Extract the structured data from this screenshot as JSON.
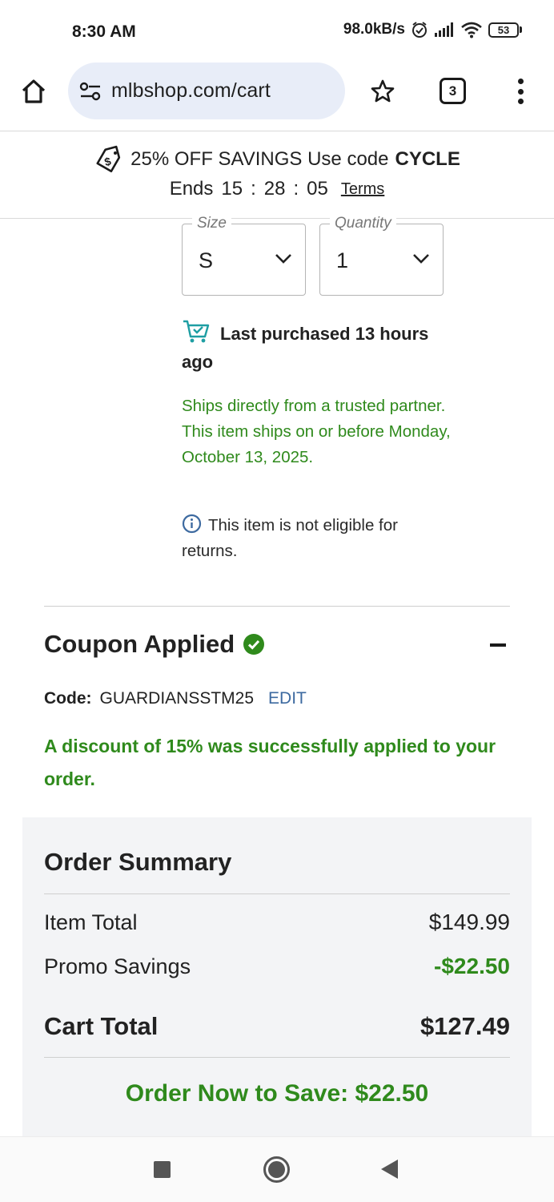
{
  "status_bar": {
    "time": "8:30 AM",
    "net_speed": "98.0kB/s",
    "battery": "53",
    "icons": [
      "alarm-icon",
      "signal-icon",
      "wifi-icon",
      "battery-icon"
    ]
  },
  "browser": {
    "url": "mlbshop.com/cart",
    "tab_count": "3",
    "icons": [
      "home-icon",
      "site-settings-icon",
      "bookmark-star-icon",
      "tabs-icon",
      "more-menu-icon"
    ]
  },
  "promo": {
    "offer_text": "25% OFF SAVINGS Use code",
    "code": "CYCLE",
    "ends_label": "Ends",
    "countdown_h": "15",
    "countdown_m": "28",
    "countdown_s": "05",
    "separator": ":",
    "terms": "Terms"
  },
  "item": {
    "size_label": "Size",
    "size_value": "S",
    "quantity_label": "Quantity",
    "quantity_value": "1",
    "last_purchased": "Last purchased 13 hours ago",
    "shipping_note": "Ships directly from a trusted partner. This item ships on or before Monday, October 13, 2025.",
    "returns_note": "This item is not eligible for returns."
  },
  "coupon": {
    "title": "Coupon Applied",
    "code_label": "Code:",
    "code_value": "GUARDIANSSTM25",
    "edit_label": "EDIT",
    "success_message": "A discount of 15% was successfully applied to your order."
  },
  "summary": {
    "title": "Order Summary",
    "item_total_label": "Item Total",
    "item_total_value": "$149.99",
    "promo_label": "Promo Savings",
    "promo_value": "-$22.50",
    "cart_total_label": "Cart Total",
    "cart_total_value": "$127.49",
    "order_now": "Order Now to Save: $22.50"
  },
  "colors": {
    "green": "#2f8a1c",
    "link_blue": "#3d6aa0",
    "url_pill": "#e8edf8",
    "summary_bg": "#f3f4f6"
  }
}
